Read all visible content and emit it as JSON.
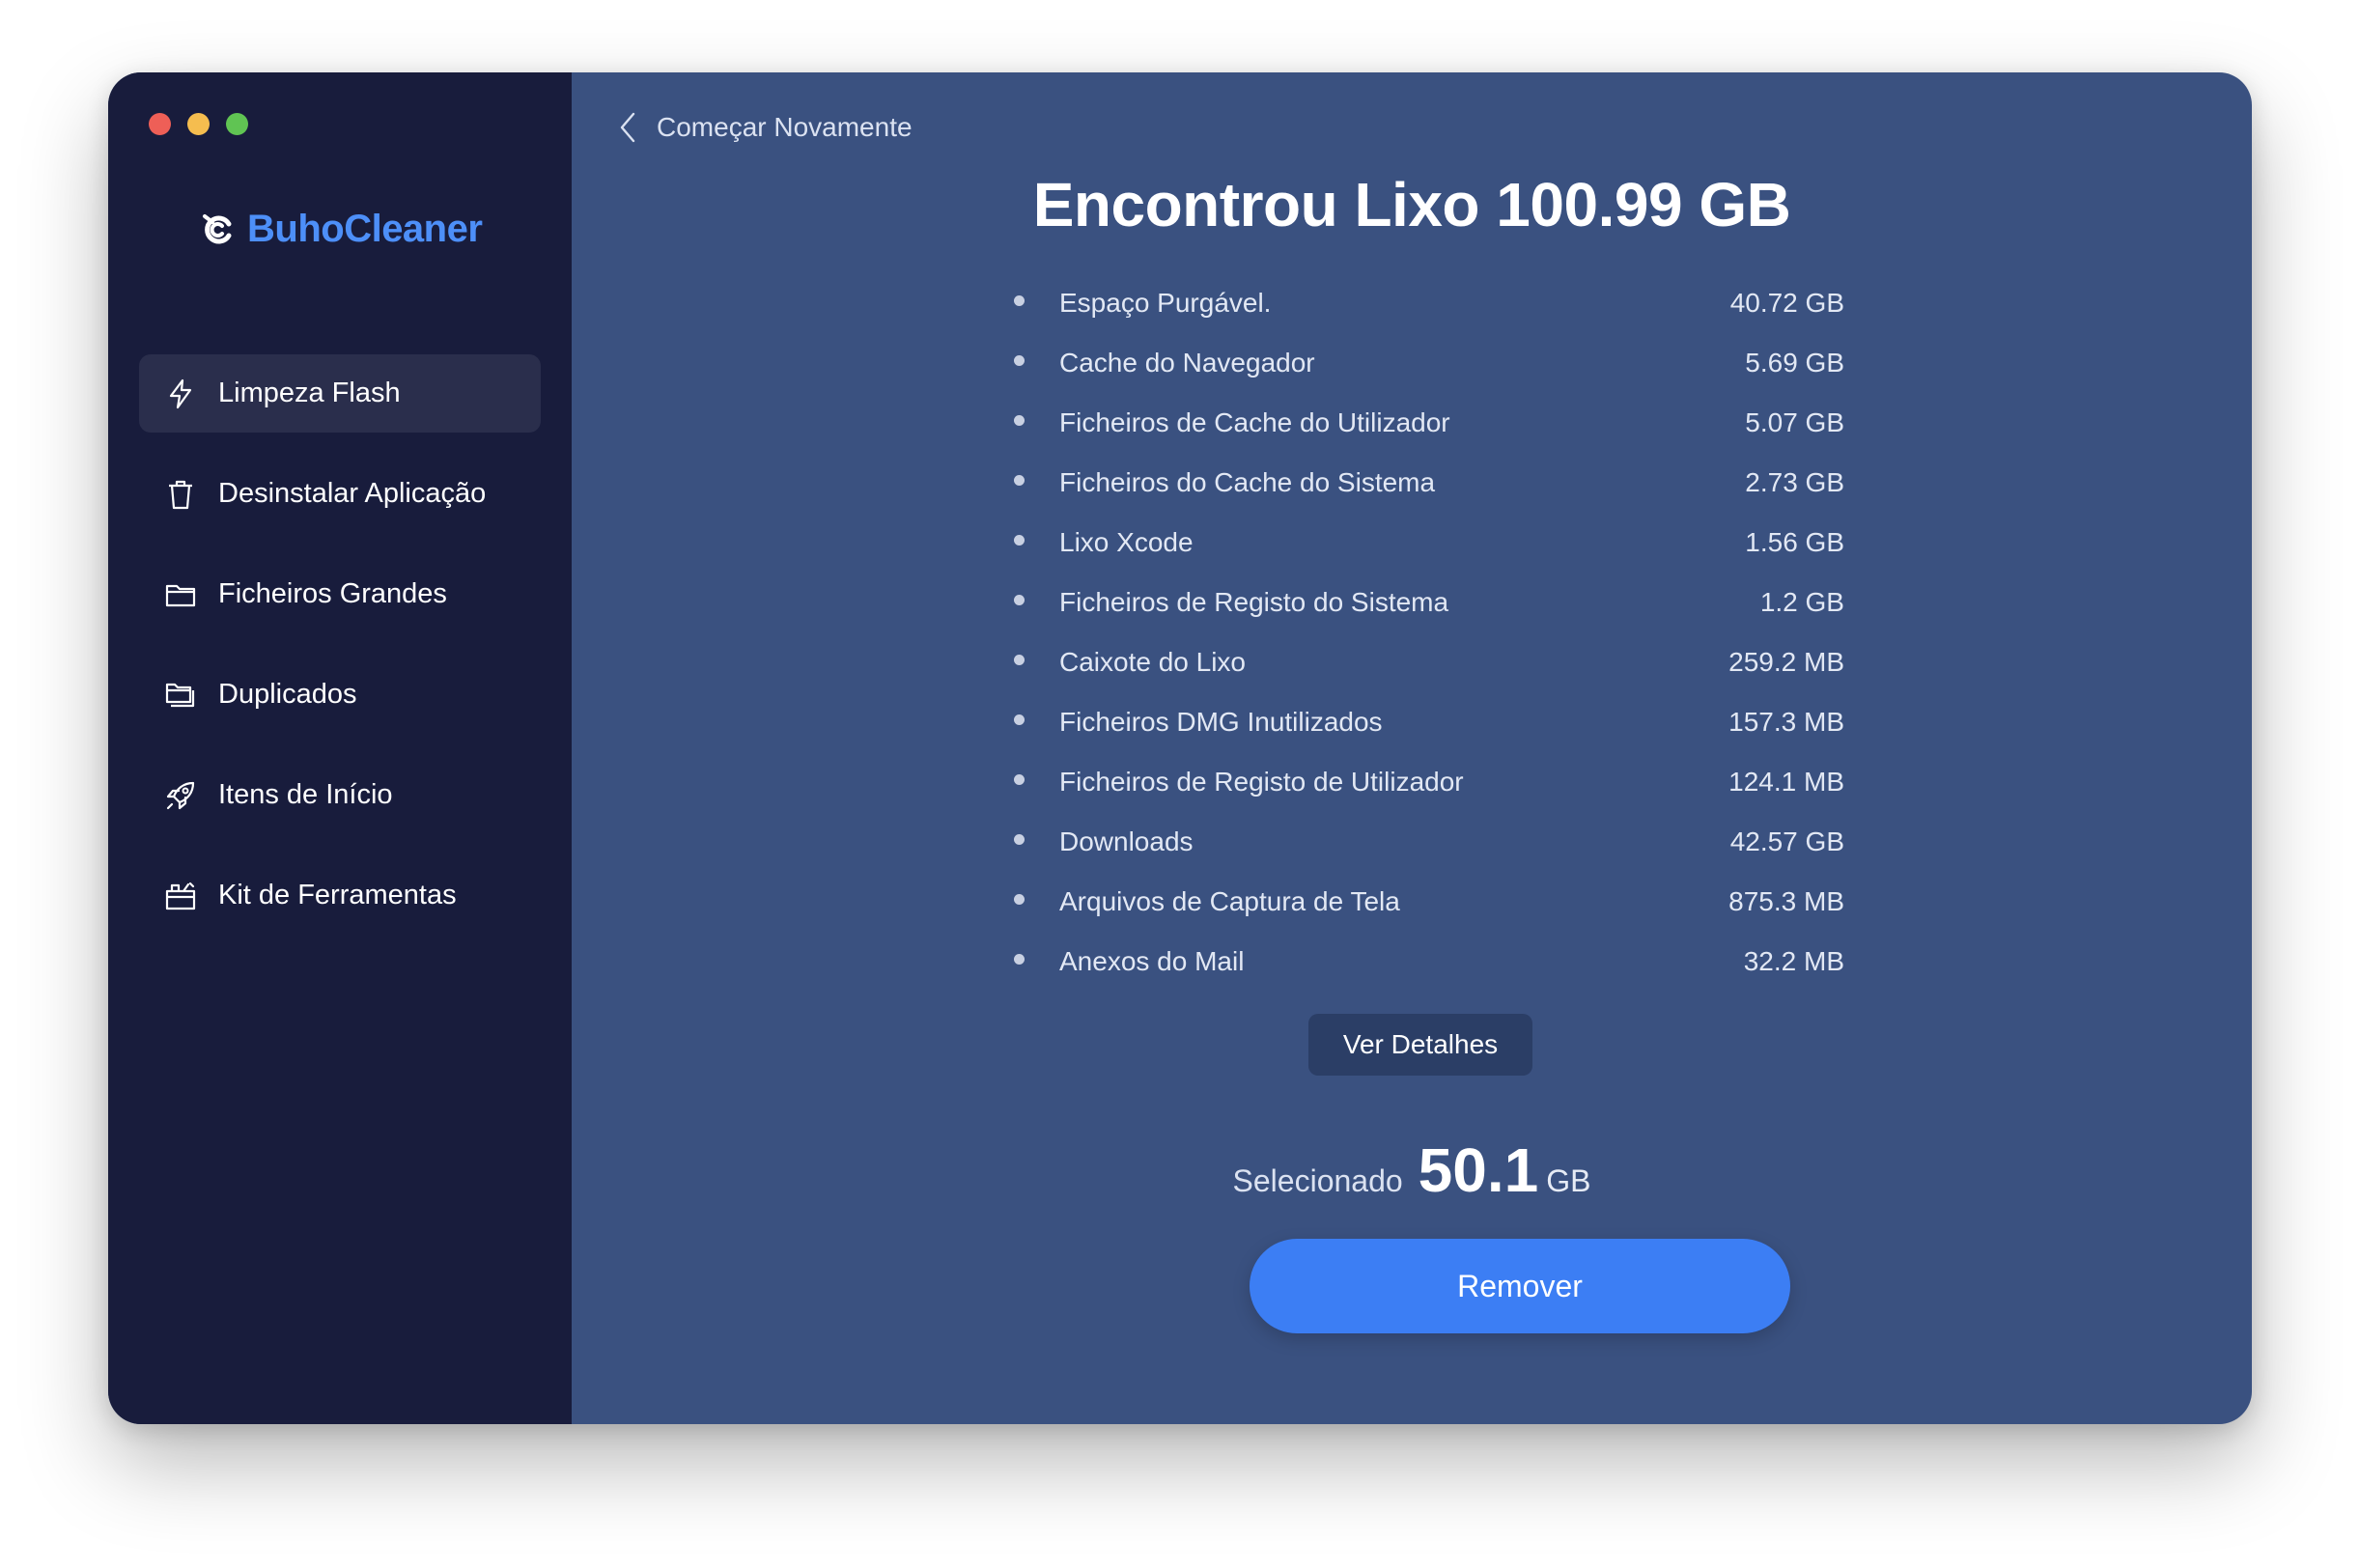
{
  "window": {
    "traffic_lights": [
      "close",
      "minimize",
      "zoom"
    ]
  },
  "brand": {
    "name": "BuhoCleaner",
    "logo_icon": "buho-logo-icon",
    "color": "#4d8ff8"
  },
  "sidebar": {
    "items": [
      {
        "label": "Limpeza Flash",
        "icon": "lightning-icon",
        "active": true
      },
      {
        "label": "Desinstalar Aplicação",
        "icon": "trash-icon",
        "active": false
      },
      {
        "label": "Ficheiros Grandes",
        "icon": "folder-icon",
        "active": false
      },
      {
        "label": "Duplicados",
        "icon": "duplicate-folder-icon",
        "active": false
      },
      {
        "label": "Itens de Início",
        "icon": "rocket-icon",
        "active": false
      },
      {
        "label": "Kit de Ferramentas",
        "icon": "toolbox-icon",
        "active": false
      }
    ]
  },
  "main": {
    "back_label": "Começar Novamente",
    "headline": {
      "prefix": "Encontrou Lixo",
      "amount": "100.99",
      "unit": "GB"
    },
    "items": [
      {
        "label": "Espaço Purgável.",
        "size": "40.72 GB"
      },
      {
        "label": "Cache do Navegador",
        "size": "5.69 GB"
      },
      {
        "label": "Ficheiros de Cache do Utilizador",
        "size": "5.07 GB"
      },
      {
        "label": "Ficheiros do Cache do Sistema",
        "size": "2.73 GB"
      },
      {
        "label": "Lixo Xcode",
        "size": "1.56 GB"
      },
      {
        "label": "Ficheiros de Registo do Sistema",
        "size": "1.2 GB"
      },
      {
        "label": "Caixote do Lixo",
        "size": "259.2 MB"
      },
      {
        "label": "Ficheiros DMG Inutilizados",
        "size": "157.3 MB"
      },
      {
        "label": "Ficheiros de Registo de Utilizador",
        "size": "124.1 MB"
      },
      {
        "label": "Downloads",
        "size": "42.57 GB"
      },
      {
        "label": "Arquivos de Captura de Tela",
        "size": "875.3 MB"
      },
      {
        "label": "Anexos do Mail",
        "size": "32.2 MB"
      }
    ],
    "details_label": "Ver Detalhes",
    "selected": {
      "label": "Selecionado",
      "value": "50.1",
      "unit": "GB"
    },
    "remove_label": "Remover"
  },
  "colors": {
    "sidebar_bg": "#181c3c",
    "main_bg": "#3a5180",
    "accent": "#3c7ef4"
  }
}
